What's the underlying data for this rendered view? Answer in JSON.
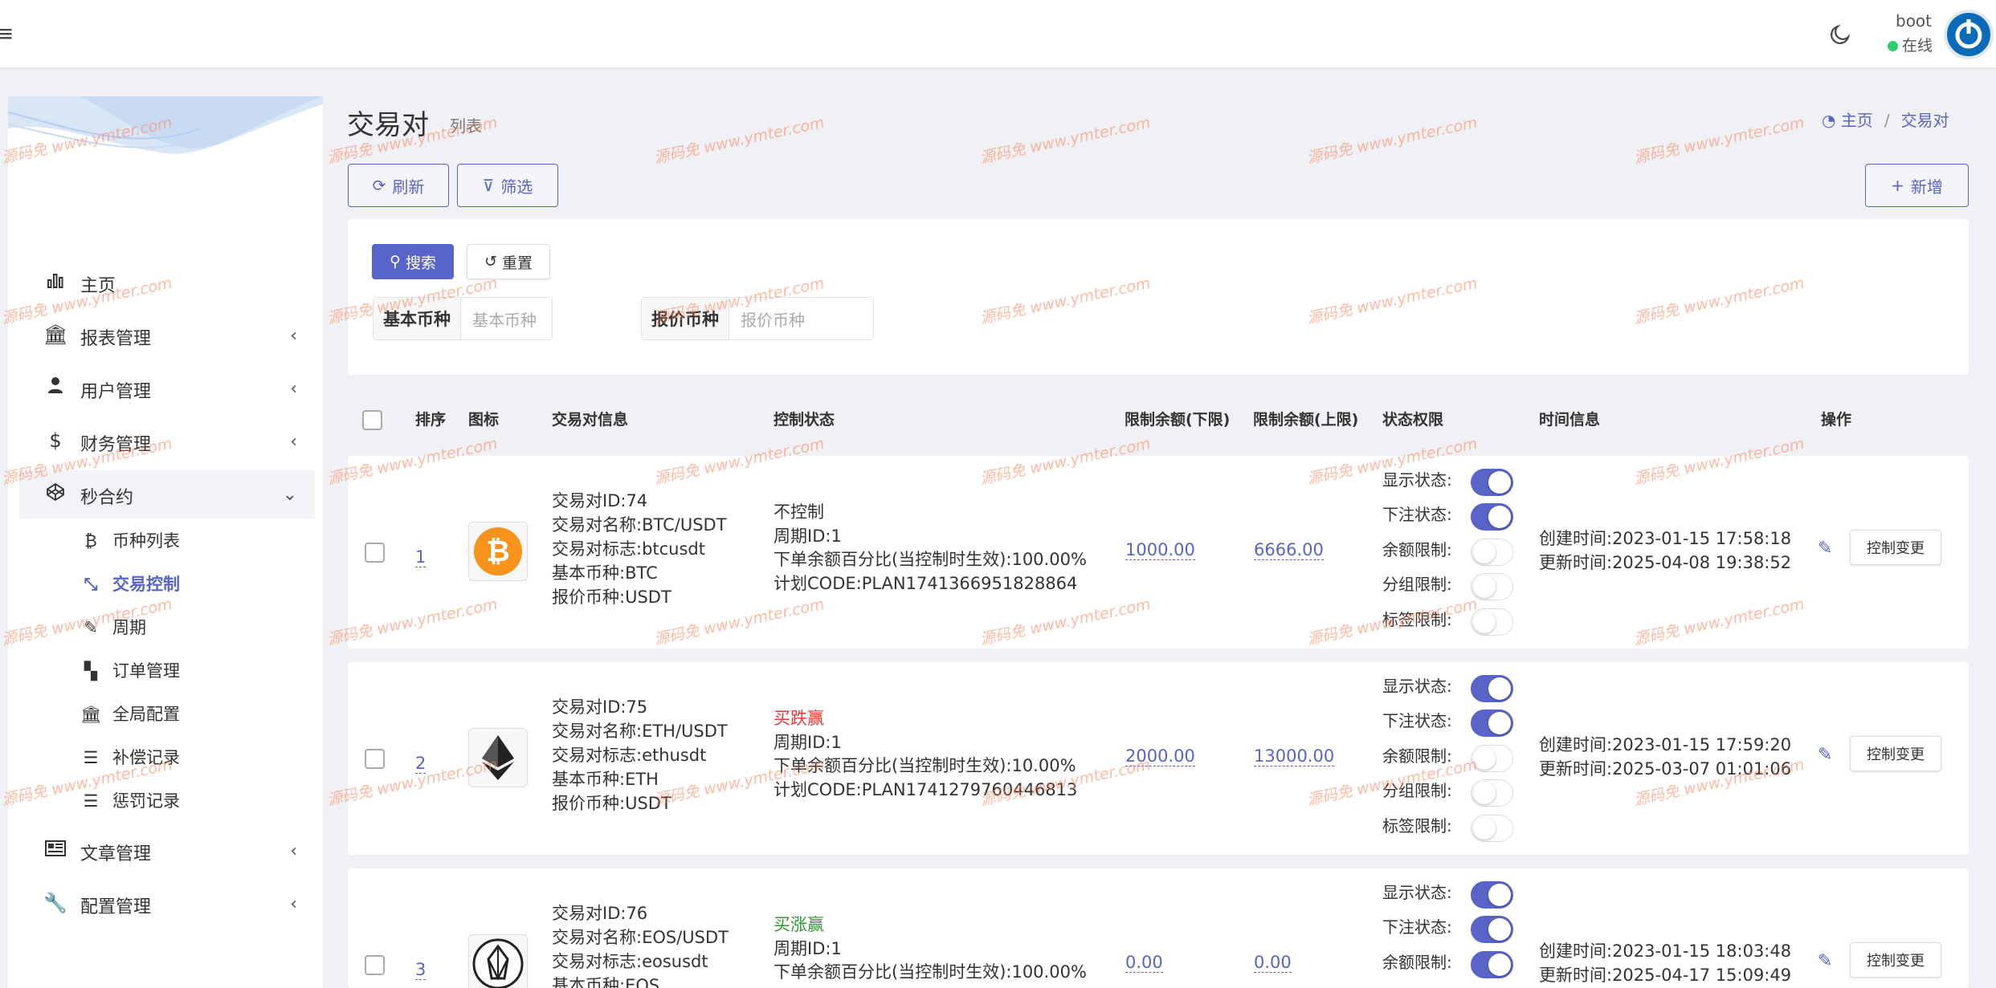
{
  "header": {
    "user_name": "boot",
    "user_status": "在线"
  },
  "sidebar": {
    "items": [
      {
        "label": "主页",
        "icon": "bar-chart-icon"
      },
      {
        "label": "报表管理",
        "icon": "bank-icon"
      },
      {
        "label": "用户管理",
        "icon": "user-tie-icon"
      },
      {
        "label": "财务管理",
        "icon": "dollar-icon"
      },
      {
        "label": "秒合约",
        "icon": "codepen-icon"
      },
      {
        "label": "文章管理",
        "icon": "newspaper-icon"
      },
      {
        "label": "配置管理",
        "icon": "wrench-icon"
      }
    ],
    "sub_items": [
      {
        "label": "币种列表",
        "icon": "bitcoin-icon"
      },
      {
        "label": "交易控制",
        "icon": "compress-icon"
      },
      {
        "label": "周期",
        "icon": "edit-square-icon"
      },
      {
        "label": "订单管理",
        "icon": "chess-board-icon"
      },
      {
        "label": "全局配置",
        "icon": "bank-icon"
      },
      {
        "label": "补偿记录",
        "icon": "list-icon"
      },
      {
        "label": "惩罚记录",
        "icon": "list-icon"
      }
    ]
  },
  "page": {
    "title": "交易对",
    "subtitle": "列表",
    "breadcrumb_home": "主页",
    "breadcrumb_current": "交易对"
  },
  "toolbar": {
    "refresh": "刷新",
    "filter": "筛选",
    "add": "新增"
  },
  "search": {
    "search_btn": "搜索",
    "reset_btn": "重置",
    "base_label": "基本币种",
    "base_placeholder": "基本币种",
    "quote_label": "报价币种",
    "quote_placeholder": "报价币种"
  },
  "table": {
    "headers": [
      "排序",
      "图标",
      "交易对信息",
      "控制状态",
      "限制余额(下限)",
      "限制余额(上限)",
      "状态权限",
      "时间信息",
      "操作"
    ],
    "perm_labels": [
      "显示状态:",
      "下注状态:",
      "余额限制:",
      "分组限制:",
      "标签限制:"
    ],
    "action_label": "控制变更",
    "rows": [
      {
        "sort": "1",
        "coin_icon": "bitcoin-icon",
        "info": [
          "交易对ID:74",
          "交易对名称:BTC/USDT",
          "交易对标志:btcusdt",
          "基本币种:BTC",
          "报价币种:USDT"
        ],
        "ctrl_status": "不控制",
        "ctrl_color": "normal",
        "ctrl_lines": [
          "周期ID:1",
          "下单余额百分比(当控制时生效):100.00%",
          "计划CODE:PLAN1741366951828864"
        ],
        "min": "1000.00",
        "max": "6666.00",
        "perms": [
          true,
          true,
          false,
          false,
          false
        ],
        "created": "创建时间:2023-01-15 17:58:18",
        "updated": "更新时间:2025-04-08 19:38:52"
      },
      {
        "sort": "2",
        "coin_icon": "ethereum-icon",
        "info": [
          "交易对ID:75",
          "交易对名称:ETH/USDT",
          "交易对标志:ethusdt",
          "基本币种:ETH",
          "报价币种:USDT"
        ],
        "ctrl_status": "买跌赢",
        "ctrl_color": "red",
        "ctrl_lines": [
          "周期ID:1",
          "下单余额百分比(当控制时生效):10.00%",
          "计划CODE:PLAN1741279760446813"
        ],
        "min": "2000.00",
        "max": "13000.00",
        "perms": [
          true,
          true,
          false,
          false,
          false
        ],
        "created": "创建时间:2023-01-15 17:59:20",
        "updated": "更新时间:2025-03-07 01:01:06"
      },
      {
        "sort": "3",
        "coin_icon": "eos-icon",
        "info": [
          "交易对ID:76",
          "交易对名称:EOS/USDT",
          "交易对标志:eosusdt",
          "基本币种:EOS"
        ],
        "ctrl_status": "买涨赢",
        "ctrl_color": "green",
        "ctrl_lines": [
          "周期ID:1",
          "下单余额百分比(当控制时生效):100.00%"
        ],
        "min": "0.00",
        "max": "0.00",
        "perms": [
          true,
          true,
          true
        ],
        "created": "创建时间:2023-01-15 18:03:48",
        "updated": "更新时间:2025-04-17 15:09:49"
      }
    ]
  },
  "watermark": "源码免 www.ymter.com",
  "colors": {
    "accent": "#5964c8",
    "red": "#e53935",
    "green": "#2e9a2e",
    "online": "#2ecc71"
  }
}
